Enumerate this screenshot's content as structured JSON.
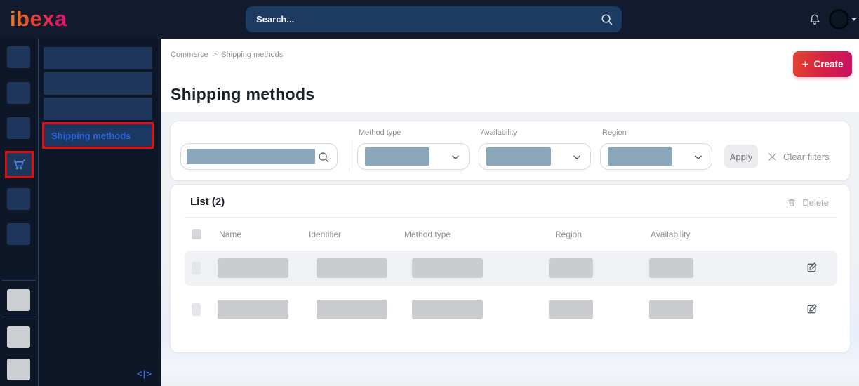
{
  "colors": {
    "topbar_bg": "#111b2d",
    "highlight_red": "#e10e0e",
    "brand_gradient_start": "#f0821f",
    "brand_gradient_end": "#e01468",
    "create_gradient_start": "#e2452c",
    "create_gradient_end": "#c90f63",
    "active_link_blue": "#2e63d9",
    "placeholder_blue": "#8ba7ba",
    "placeholder_gray": "#cacccf"
  },
  "topbar": {
    "logo_text": "ibexa",
    "search_placeholder": "Search..."
  },
  "menu": {
    "active_item_label": "Shipping methods",
    "collapse_icon": "<|>"
  },
  "breadcrumb": {
    "item1": "Commerce",
    "separator": ">",
    "item2": "Shipping methods"
  },
  "page": {
    "title": "Shipping methods",
    "create_plus": "+",
    "create_label": "Create"
  },
  "filters": {
    "method_type_label": "Method type",
    "availability_label": "Availability",
    "region_label": "Region",
    "apply_label": "Apply",
    "clear_filters_label": "Clear filters"
  },
  "list": {
    "title": "List (2)",
    "delete_label": "Delete",
    "columns": {
      "name": "Name",
      "identifier": "Identifier",
      "method_type": "Method type",
      "region": "Region",
      "availability": "Availability"
    },
    "row_count": 2
  }
}
